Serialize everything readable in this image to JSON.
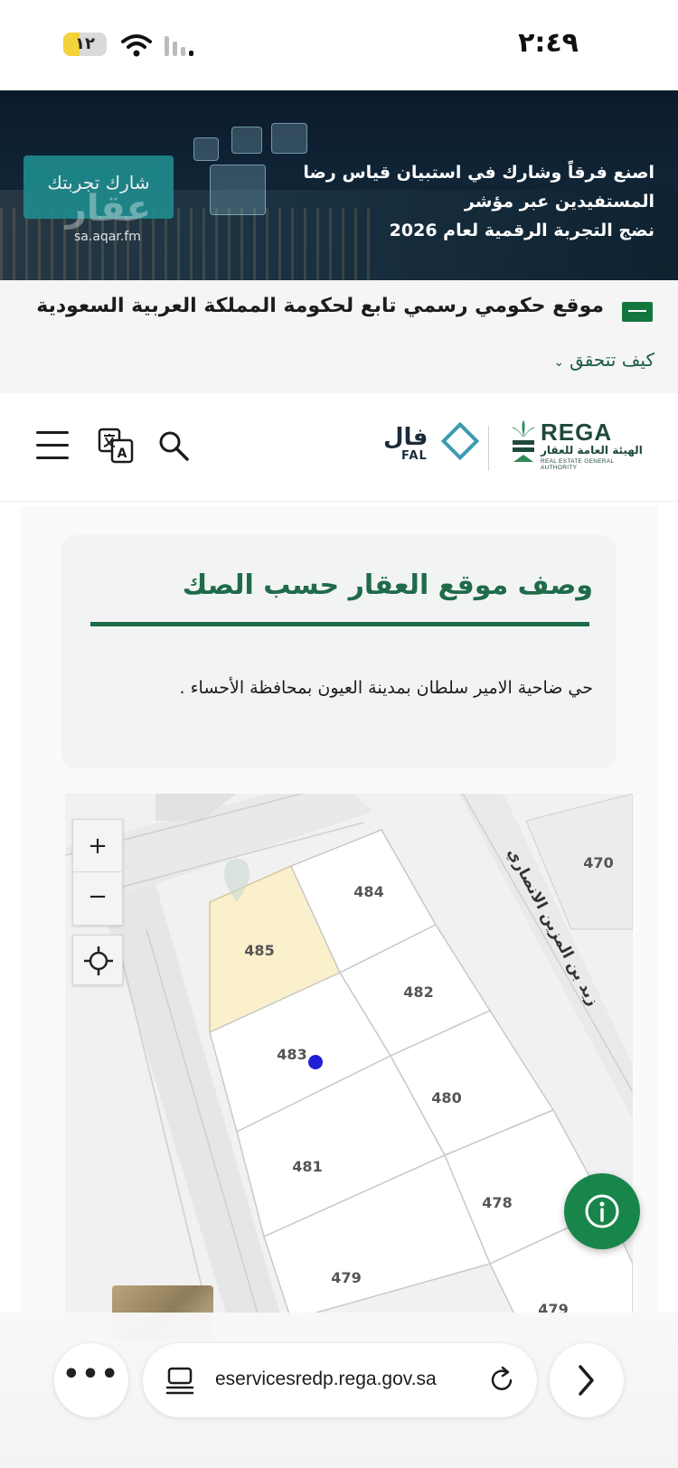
{
  "status_bar": {
    "time": "٢:٤٩",
    "battery_level": "١٢"
  },
  "banner": {
    "line1": "اصنع فرقاً وشارك في استبيان قياس رضا المستفيدين عبر مؤشر",
    "line2": "نضج التجربة الرقمية لعام 2026",
    "share_label": "شارك تجربتك",
    "logo_text": "عقار",
    "url": "sa.aqar.fm"
  },
  "gov_strip": {
    "text": "موقع حكومي رسمي تابع لحكومة المملكة العربية السعودية",
    "verify_link": "كيف تتحقق"
  },
  "header": {
    "fal_logo": "فال",
    "fal_sub": "FAL",
    "rega_title": "REGA",
    "rega_ar": "الهيئة العامة للعقار",
    "rega_en": "REAL ESTATE GENERAL AUTHORITY"
  },
  "location_card": {
    "title": "وصف موقع العقار حسب الصك",
    "description": "حي ضاحية الامير سلطان بمدينة العيون بمحافظة الأحساء ."
  },
  "map": {
    "street_name": "زيد بن المزين الانصاري",
    "parcels": [
      "485",
      "484",
      "482",
      "483",
      "480",
      "481",
      "478",
      "479",
      "470",
      "479"
    ],
    "highlighted_parcel": "485",
    "zoom_in": "+",
    "zoom_out": "−",
    "colors": {
      "highlight": "#fbf0cc",
      "marker": "#1f1fd6",
      "info": "#18864a"
    }
  },
  "browser": {
    "url": "eservicesredp.rega.gov.sa",
    "more_label": "•••"
  }
}
